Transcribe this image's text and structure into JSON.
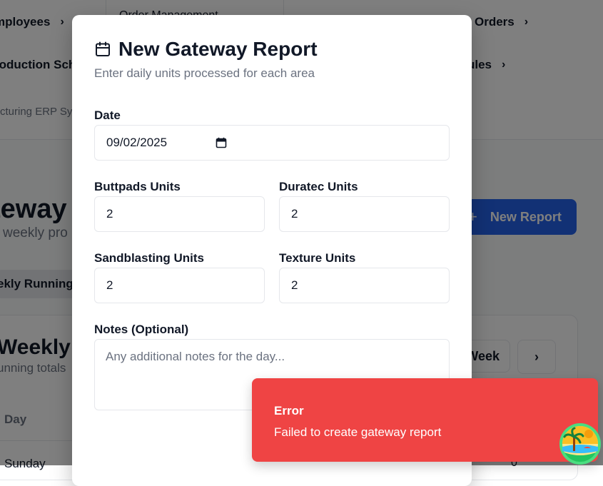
{
  "background": {
    "nav": {
      "employees": "mployees",
      "orders": "Orders",
      "production": "roduction Sch",
      "schedules": "ules",
      "dropdown_item": "Order Management",
      "app_sub": "cturing ERP Sy"
    },
    "page": {
      "title": "teway",
      "description": "weekly pro",
      "new_report": "New Report",
      "tab_weekly": "ekly Running"
    },
    "card": {
      "title": "Weekly R",
      "subtitle": "unning totals",
      "week_button": "Week",
      "table_header_day": "Day",
      "first_row_day": "Sunday",
      "first_row_value": "0"
    }
  },
  "modal": {
    "title": "New Gateway Report",
    "description": "Enter daily units processed for each area",
    "date_label": "Date",
    "date_value": "09/02/2025",
    "buttpads_label": "Buttpads Units",
    "buttpads_value": "2",
    "duratec_label": "Duratec Units",
    "duratec_value": "2",
    "sandblasting_label": "Sandblasting Units",
    "sandblasting_value": "2",
    "texture_label": "Texture Units",
    "texture_value": "2",
    "notes_label": "Notes (Optional)",
    "notes_placeholder": "Any additional notes for the day..."
  },
  "toast": {
    "title": "Error",
    "message": "Failed to create gateway report"
  },
  "icons": {
    "modal_calendar": "calendar-icon",
    "date_picker": "calendar-picker-icon",
    "plus": "plus-icon",
    "chevron": "chevron-right-icon",
    "badge": "island-avatar-icon"
  },
  "colors": {
    "primary": "#2563eb",
    "error": "#ef4444",
    "overlay": "rgba(0,0,0,0.5)"
  }
}
